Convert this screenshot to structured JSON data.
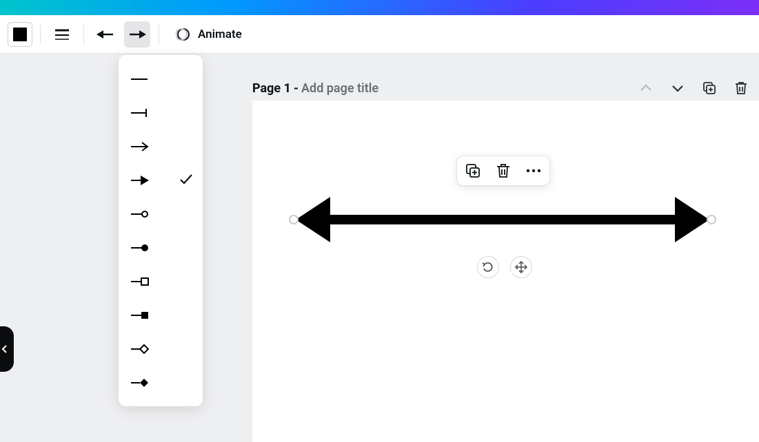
{
  "toolbar": {
    "animate_label": "Animate"
  },
  "page_header": {
    "title": "Page 1",
    "subtitle": "Add page title"
  },
  "line_end_options": [
    {
      "id": "none",
      "selected": false
    },
    {
      "id": "bar",
      "selected": false
    },
    {
      "id": "open-arrow",
      "selected": false
    },
    {
      "id": "solid-arrow",
      "selected": true
    },
    {
      "id": "open-circle",
      "selected": false
    },
    {
      "id": "solid-circle",
      "selected": false
    },
    {
      "id": "open-square",
      "selected": false
    },
    {
      "id": "solid-square",
      "selected": false
    },
    {
      "id": "open-diamond",
      "selected": false
    },
    {
      "id": "solid-diamond",
      "selected": false
    }
  ],
  "colors": {
    "foreground": "#000000"
  }
}
